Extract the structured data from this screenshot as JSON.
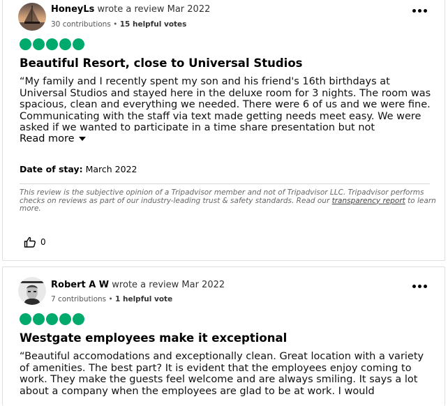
{
  "reviews": [
    {
      "username": "HoneyLs",
      "action": "wrote a review Mar 2022",
      "contributions": "30 contributions",
      "separator": "•",
      "helpful_votes": "15 helpful votes",
      "rating": 5,
      "title": "Beautiful Resort, close to Universal Studios",
      "text": "“My family and I recently spent my son and his friend's 16th birthdays at Universal Studios and stayed here in the deluxe room for 3 nights. The room was spacious, clean and everything we needed. There were 6 of us and we were fine. Communicating with the staff via text made getting needs meet easy. We were asked if we wanted to participate in a time share presentation but not",
      "read_more": "Read more",
      "date_of_stay_label": "Date of stay:",
      "date_of_stay": "March 2022",
      "disclaimer": "This review is the subjective opinion of a Tripadvisor member and not of Tripadvisor LLC. Tripadvisor performs checks on reviews as part of our industry-leading trust & safety standards. Read our",
      "disclaimer_link": "transparency report",
      "disclaimer_end": "to learn more.",
      "helpful_count": "0"
    },
    {
      "username": "Robert A W",
      "action": "wrote a review Mar 2022",
      "contributions": "7 contributions",
      "separator": "•",
      "helpful_votes": "1 helpful vote",
      "rating": 5,
      "title": "Westgate employees make it exceptional",
      "text": "“Beautiful accomodations and exceptionally clean. Great location with a variety of amenities. The best part? It is evident that the employees enjoy coming to work. They make the guests feel welcome and are always smiling. It says a lot about a company when the employees are glad to be at work. I would"
    }
  ],
  "icons": {
    "more": "more-options-icon",
    "helpful": "thumbs-up-icon",
    "caret": "chevron-down-icon"
  },
  "colors": {
    "rating_bubble": "#00aa6c"
  }
}
